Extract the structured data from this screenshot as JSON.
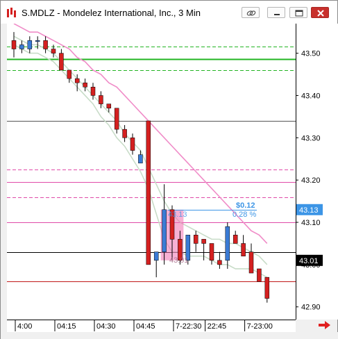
{
  "window": {
    "title": "S.MDLZ - Mondelez International, Inc., 3 Min"
  },
  "title_buttons": [
    "link-icon",
    "minimize-icon",
    "maximize-icon",
    "close-icon"
  ],
  "price_axis": {
    "ticks": [
      "43.50",
      "43.40",
      "43.30",
      "43.20",
      "43.10",
      "43.00",
      "42.90"
    ],
    "flag_blue": "43.13",
    "flag_dark": "43.01"
  },
  "time_axis": {
    "labels": [
      "4:00",
      "04:15",
      "04:30",
      "04:45",
      "7-22:30",
      "22:45",
      "7-23:00"
    ]
  },
  "measure_tool": {
    "change": "$0.12",
    "percent": "0.28 %",
    "start_price": "43.13",
    "end_price": "43.01"
  },
  "colors": {
    "bull": "#3a7bd5",
    "bear": "#d42020",
    "green_line": "#22b422",
    "pink_line": "#f07ac8",
    "measure_fill": "#f06fb0",
    "flag_blue": "#3c95e6",
    "flag_dark": "#000000"
  },
  "chart_data": {
    "type": "candlestick",
    "title": "S.MDLZ - Mondelez International, Inc., 3 Min",
    "ylim": [
      42.87,
      43.57
    ],
    "x": [
      "04:00",
      "",
      "",
      "",
      "",
      "",
      "04:15",
      "",
      "",
      "",
      "",
      "04:30",
      "",
      "",
      "",
      "",
      "04:45",
      "",
      "",
      "",
      "",
      "7-22:30",
      "",
      "",
      "",
      "22:45",
      "",
      "",
      "",
      "",
      "7-23:00",
      "",
      "",
      "",
      "",
      ""
    ],
    "candles": [
      {
        "open": 43.53,
        "high": 43.55,
        "low": 43.49,
        "close": 43.51
      },
      {
        "open": 43.51,
        "high": 43.53,
        "low": 43.5,
        "close": 43.52
      },
      {
        "open": 43.51,
        "high": 43.54,
        "low": 43.5,
        "close": 43.53
      },
      {
        "open": 43.53,
        "high": 43.54,
        "low": 43.51,
        "close": 43.53
      },
      {
        "open": 43.53,
        "high": 43.54,
        "low": 43.5,
        "close": 43.51
      },
      {
        "open": 43.51,
        "high": 43.52,
        "low": 43.49,
        "close": 43.5
      },
      {
        "open": 43.5,
        "high": 43.51,
        "low": 43.46,
        "close": 43.46
      },
      {
        "open": 43.46,
        "high": 43.46,
        "low": 43.43,
        "close": 43.44
      },
      {
        "open": 43.44,
        "high": 43.45,
        "low": 43.41,
        "close": 43.43
      },
      {
        "open": 43.43,
        "high": 43.44,
        "low": 43.41,
        "close": 43.42
      },
      {
        "open": 43.42,
        "high": 43.43,
        "low": 43.39,
        "close": 43.4
      },
      {
        "open": 43.4,
        "high": 43.41,
        "low": 43.37,
        "close": 43.38
      },
      {
        "open": 43.38,
        "high": 43.38,
        "low": 43.36,
        "close": 43.37
      },
      {
        "open": 43.37,
        "high": 43.35,
        "low": 43.31,
        "close": 43.32
      },
      {
        "open": 43.32,
        "high": 43.33,
        "low": 43.29,
        "close": 43.3
      },
      {
        "open": 43.3,
        "high": 43.31,
        "low": 43.26,
        "close": 43.27
      },
      {
        "open": 43.24,
        "high": 43.27,
        "low": 43.24,
        "close": 43.26
      },
      {
        "open": 43.34,
        "high": 43.34,
        "low": 43.0,
        "close": 43.0
      },
      {
        "open": 43.01,
        "high": 43.03,
        "low": 42.97,
        "close": 43.03
      },
      {
        "open": 43.03,
        "high": 43.19,
        "low": 43.0,
        "close": 43.13
      },
      {
        "open": 43.13,
        "high": 43.14,
        "low": 43.01,
        "close": 43.06
      },
      {
        "open": 43.06,
        "high": 43.08,
        "low": 43.0,
        "close": 43.01
      },
      {
        "open": 43.01,
        "high": 43.07,
        "low": 43.0,
        "close": 43.07
      },
      {
        "open": 43.07,
        "high": 43.08,
        "low": 43.03,
        "close": 43.05
      },
      {
        "open": 43.06,
        "high": 43.06,
        "low": 43.01,
        "close": 43.05
      },
      {
        "open": 43.05,
        "high": 43.05,
        "low": 43.0,
        "close": 43.01
      },
      {
        "open": 43.01,
        "high": 43.03,
        "low": 42.99,
        "close": 43.0
      },
      {
        "open": 43.01,
        "high": 43.1,
        "low": 42.99,
        "close": 43.09
      },
      {
        "open": 43.07,
        "high": 43.08,
        "low": 43.05,
        "close": 43.05
      },
      {
        "open": 43.05,
        "high": 43.07,
        "low": 43.02,
        "close": 43.02
      },
      {
        "open": 43.03,
        "high": 43.05,
        "low": 42.98,
        "close": 42.98
      },
      {
        "open": 42.99,
        "high": 42.99,
        "low": 42.96,
        "close": 42.96
      },
      {
        "open": 42.97,
        "high": 42.97,
        "low": 42.91,
        "close": 42.92
      }
    ],
    "horizontal_lines": [
      {
        "value": 43.515,
        "color": "#22b422",
        "style": "dash"
      },
      {
        "value": 43.487,
        "color": "#22b422",
        "style": "solid"
      },
      {
        "value": 43.46,
        "color": "#22b422",
        "style": "dash"
      },
      {
        "value": 43.34,
        "color": "#555555",
        "style": "solid"
      },
      {
        "value": 43.225,
        "color": "#e04aa8",
        "style": "dash"
      },
      {
        "value": 43.195,
        "color": "#e04aa8",
        "style": "solid"
      },
      {
        "value": 43.16,
        "color": "#e04aa8",
        "style": "dash"
      },
      {
        "value": 43.1,
        "color": "#e04aa8",
        "style": "solid"
      },
      {
        "value": 43.03,
        "color": "#000000",
        "style": "solid"
      },
      {
        "value": 42.96,
        "color": "#c01818",
        "style": "solid"
      }
    ],
    "moving_averages": [
      {
        "name": "",
        "color": "#f08cc8",
        "values": [
          43.57,
          43.56,
          43.55,
          43.55,
          43.54,
          43.53,
          43.52,
          43.51,
          43.49,
          43.48,
          43.46,
          43.45,
          43.43,
          43.42,
          43.4,
          43.38,
          43.36,
          43.34,
          43.32,
          43.3,
          43.28,
          43.26,
          43.24,
          43.22,
          43.2,
          43.18,
          43.16,
          43.14,
          43.12,
          43.1,
          43.08,
          43.07,
          43.05
        ]
      },
      {
        "name": "",
        "color": "#c8dcc8",
        "values": [
          43.54,
          43.53,
          43.52,
          43.52,
          43.51,
          43.5,
          43.48,
          43.46,
          43.44,
          43.42,
          43.4,
          43.38,
          43.36,
          43.34,
          43.31,
          43.29,
          43.27,
          43.23,
          43.19,
          43.15,
          43.12,
          43.1,
          43.09,
          43.08,
          43.07,
          43.06,
          43.06,
          43.05,
          43.05,
          43.04,
          43.03,
          43.02,
          43.0
        ]
      },
      {
        "name": "",
        "color": "#c8dcc8",
        "values": [
          43.52,
          43.51,
          43.5,
          43.5,
          43.49,
          43.48,
          43.46,
          43.44,
          43.42,
          43.4,
          43.38,
          43.35,
          43.33,
          43.3,
          43.28,
          43.25,
          43.22,
          43.18,
          43.12,
          43.06,
          43.03,
          43.03,
          43.02,
          43.02,
          43.02,
          43.01,
          43.0,
          43.0,
          42.99,
          42.99,
          42.99,
          42.98,
          42.97
        ]
      }
    ]
  }
}
